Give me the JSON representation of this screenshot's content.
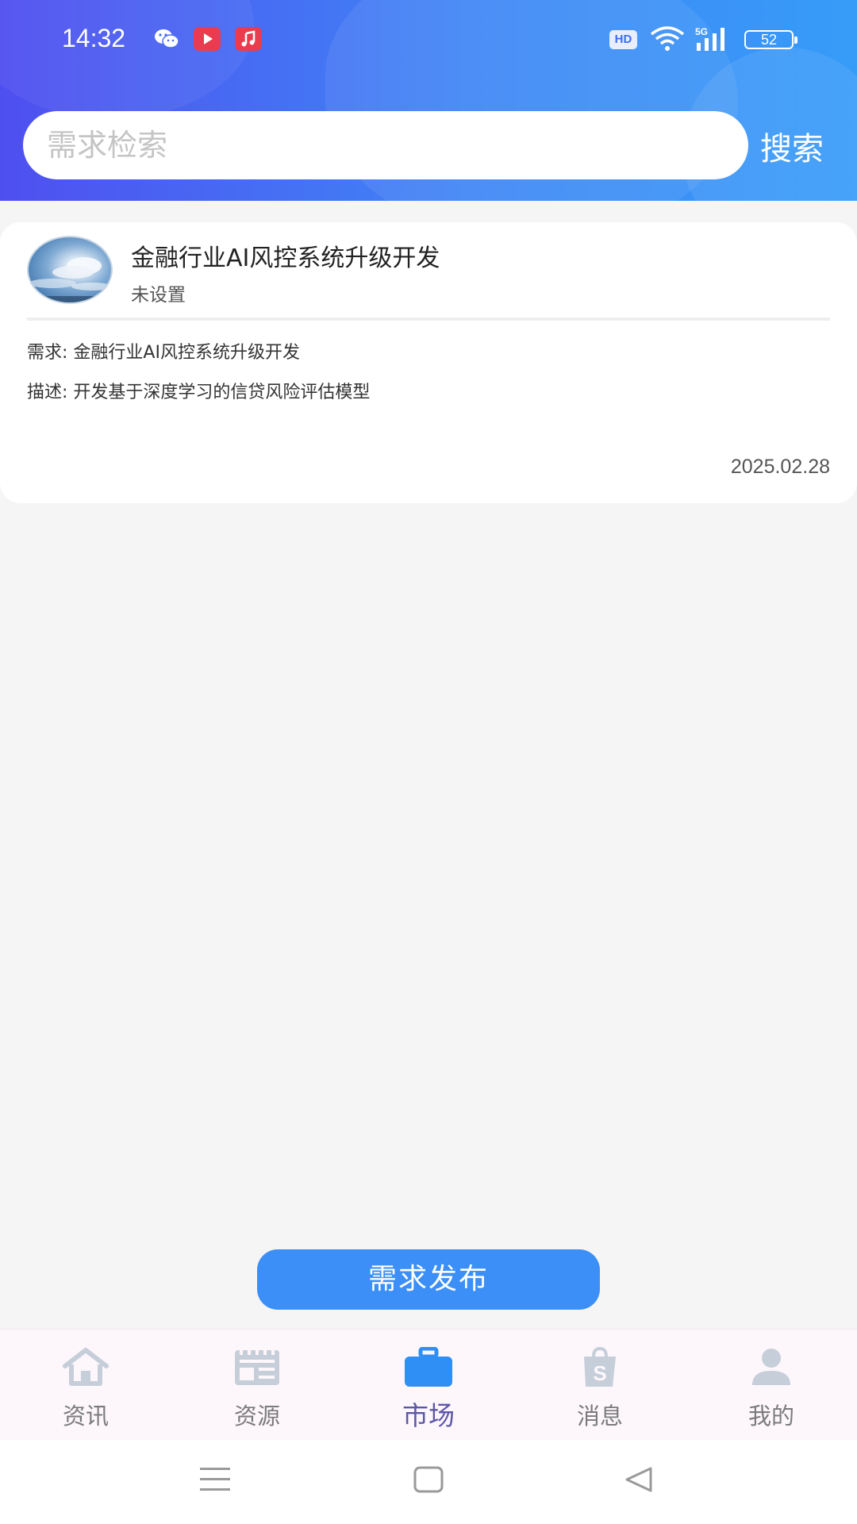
{
  "status_bar": {
    "time": "14:32",
    "hd_label": "HD",
    "network": "5G",
    "battery": "52",
    "app_icons": [
      "wechat-icon",
      "video-icon",
      "music-icon"
    ]
  },
  "search": {
    "placeholder": "需求检索",
    "value": "",
    "button_label": "搜索"
  },
  "card": {
    "title": "金融行业AI风控系统升级开发",
    "subtitle": "未设置",
    "demand": "需求: 金融行业AI风控系统升级开发",
    "description": "描述: 开发基于深度学习的信贷风险评估模型",
    "date": "2025.02.28"
  },
  "publish_button": "需求发布",
  "bottom_nav": {
    "items": [
      {
        "label": "资讯",
        "icon": "home-icon",
        "active": false
      },
      {
        "label": "资源",
        "icon": "newspaper-icon",
        "active": false
      },
      {
        "label": "市场",
        "icon": "briefcase-icon",
        "active": true
      },
      {
        "label": "消息",
        "icon": "shopping-bag-icon",
        "active": false
      },
      {
        "label": "我的",
        "icon": "user-icon",
        "active": false
      }
    ]
  },
  "colors": {
    "header_gradient_start": "#4f4ff0",
    "header_gradient_end": "#379cf8",
    "accent": "#3b8ff6",
    "active_nav_label": "#5e57a8",
    "inactive_icon": "#c6ced9"
  }
}
